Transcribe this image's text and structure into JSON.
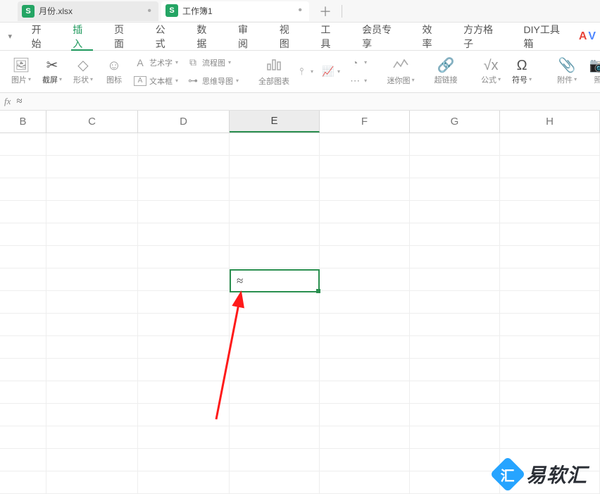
{
  "tabs": {
    "doc1": {
      "label": "月份.xlsx"
    },
    "doc2": {
      "label": "工作簿1"
    }
  },
  "menu": {
    "start": "开始",
    "insert": "插入",
    "page": "页面",
    "formula": "公式",
    "data": "数据",
    "review": "审阅",
    "view": "视图",
    "tools": "工具",
    "member": "会员专享",
    "efficiency": "效率",
    "square": "方方格子",
    "diy": "DIY工具箱"
  },
  "ribbon": {
    "pic": "图片",
    "screenshot": "截屏",
    "shape": "形状",
    "icon": "图标",
    "wordart": "艺术字",
    "textbox": "文本框",
    "flowchart": "流程图",
    "mindmap": "思维导图",
    "allcharts": "全部图表",
    "sparkline": "迷你图",
    "hyperlink": "超链接",
    "formula": "公式",
    "symbol": "符号",
    "attach": "附件",
    "camera": "照"
  },
  "formula": {
    "fx": "fx",
    "value": "≈"
  },
  "columns": [
    "B",
    "C",
    "D",
    "E",
    "F",
    "G",
    "H"
  ],
  "active_cell": {
    "value": "≈"
  },
  "watermark": "易软汇"
}
